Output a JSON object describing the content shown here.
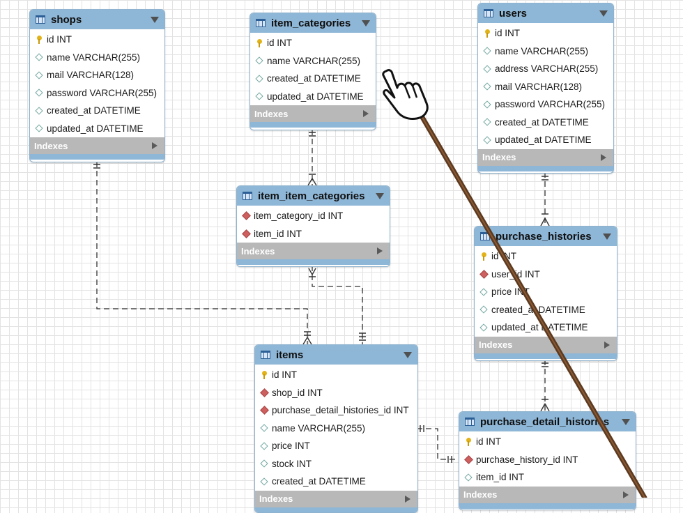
{
  "indexes_label": "Indexes",
  "colors": {
    "header": "#8eb6d6",
    "indexes_bar": "#b8b8b8",
    "connector": "#333333",
    "stylus": "#5c3a20"
  },
  "entities": {
    "shops": {
      "title": "shops",
      "columns": [
        {
          "name": "id INT",
          "kind": "primary-key"
        },
        {
          "name": "name VARCHAR(255)",
          "kind": "column"
        },
        {
          "name": "mail VARCHAR(128)",
          "kind": "column"
        },
        {
          "name": "password VARCHAR(255)",
          "kind": "column"
        },
        {
          "name": "created_at DATETIME",
          "kind": "column"
        },
        {
          "name": "updated_at DATETIME",
          "kind": "column"
        }
      ]
    },
    "item_categories": {
      "title": "item_categories",
      "columns": [
        {
          "name": "id INT",
          "kind": "primary-key"
        },
        {
          "name": "name VARCHAR(255)",
          "kind": "column"
        },
        {
          "name": "created_at DATETIME",
          "kind": "column"
        },
        {
          "name": "updated_at DATETIME",
          "kind": "column"
        }
      ]
    },
    "users": {
      "title": "users",
      "columns": [
        {
          "name": "id INT",
          "kind": "primary-key"
        },
        {
          "name": "name VARCHAR(255)",
          "kind": "column"
        },
        {
          "name": "address VARCHAR(255)",
          "kind": "column"
        },
        {
          "name": "mail VARCHAR(128)",
          "kind": "column"
        },
        {
          "name": "password VARCHAR(255)",
          "kind": "column"
        },
        {
          "name": "created_at DATETIME",
          "kind": "column"
        },
        {
          "name": "updated_at DATETIME",
          "kind": "column"
        }
      ]
    },
    "item_item_categories": {
      "title": "item_item_categories",
      "columns": [
        {
          "name": "item_category_id INT",
          "kind": "foreign-key"
        },
        {
          "name": "item_id INT",
          "kind": "foreign-key"
        }
      ]
    },
    "purchase_histories": {
      "title": "purchase_histories",
      "columns": [
        {
          "name": "id INT",
          "kind": "primary-key"
        },
        {
          "name": "user_id INT",
          "kind": "foreign-key"
        },
        {
          "name": "price INT",
          "kind": "column"
        },
        {
          "name": "created_at DATETIME",
          "kind": "column"
        },
        {
          "name": "updated_at DATETIME",
          "kind": "column"
        }
      ]
    },
    "items": {
      "title": "items",
      "columns": [
        {
          "name": "id INT",
          "kind": "primary-key"
        },
        {
          "name": "shop_id INT",
          "kind": "foreign-key"
        },
        {
          "name": "purchase_detail_histories_id INT",
          "kind": "foreign-key"
        },
        {
          "name": "name VARCHAR(255)",
          "kind": "column"
        },
        {
          "name": "price INT",
          "kind": "column"
        },
        {
          "name": "stock INT",
          "kind": "column"
        },
        {
          "name": "created_at DATETIME",
          "kind": "column"
        }
      ]
    },
    "purchase_detail_histories": {
      "title": "purchase_detail_histories",
      "columns": [
        {
          "name": "id INT",
          "kind": "primary-key"
        },
        {
          "name": "purchase_history_id INT",
          "kind": "foreign-key"
        },
        {
          "name": "item_id INT",
          "kind": "column"
        }
      ]
    }
  }
}
